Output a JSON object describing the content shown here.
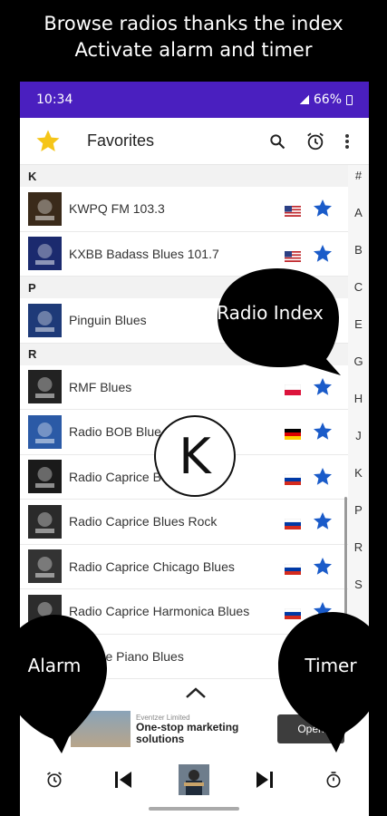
{
  "captions": {
    "line1": "Browse radios thanks the index",
    "line2": "Activate alarm and timer"
  },
  "status_bar": {
    "time": "10:34",
    "battery": "66%"
  },
  "app_bar": {
    "title": "Favorites",
    "icons": [
      "star-icon",
      "search-icon",
      "alarm-icon",
      "more-vert-icon"
    ]
  },
  "sections": [
    {
      "letter": "K",
      "stations": [
        {
          "name": "KWPQ FM 103.3",
          "flag": "us",
          "favorite": true
        },
        {
          "name": "KXBB Badass Blues 101.7",
          "flag": "us",
          "favorite": true
        }
      ]
    },
    {
      "letter": "P",
      "stations": [
        {
          "name": "Pinguin Blues",
          "flag": "",
          "favorite": false
        }
      ]
    },
    {
      "letter": "R",
      "stations": [
        {
          "name": "RMF Blues",
          "flag": "pl",
          "favorite": true
        },
        {
          "name": "Radio BOB Blue",
          "flag": "de",
          "favorite": true
        },
        {
          "name": "Radio Caprice B",
          "flag": "ru",
          "favorite": true
        },
        {
          "name": "Radio Caprice Blues Rock",
          "flag": "ru",
          "favorite": true
        },
        {
          "name": "Radio Caprice Chicago Blues",
          "flag": "ru",
          "favorite": true
        },
        {
          "name": "Radio Caprice Harmonica Blues",
          "flag": "ru",
          "favorite": true
        },
        {
          "name": "Caprice Piano Blues",
          "flag": "ru",
          "favorite": false
        }
      ]
    }
  ],
  "index_letters": [
    "#",
    "A",
    "B",
    "C",
    "E",
    "G",
    "H",
    "J",
    "K",
    "P",
    "R",
    "S"
  ],
  "index_bubble": "K",
  "callouts": {
    "radio_index": "Radio Index",
    "alarm": "Alarm",
    "timer": "Timer"
  },
  "ad": {
    "advertiser": "Eventzer Limited",
    "headline_1": "One-stop marketing",
    "headline_2": "solutions",
    "button": "Open"
  },
  "colors": {
    "status_bar": "#4a1fbf",
    "star_yellow": "#f5c518",
    "star_blue": "#1a5bc9",
    "callout": "#000000"
  }
}
